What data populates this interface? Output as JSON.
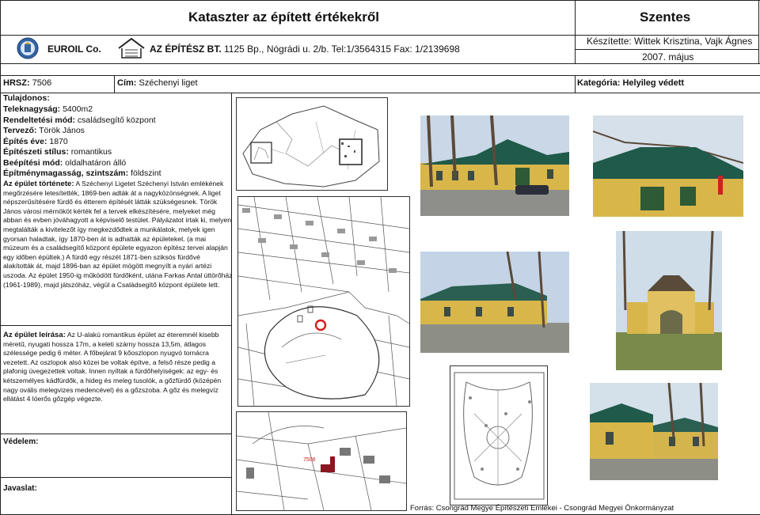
{
  "header": {
    "title": "Kataszter az épített értékekről",
    "city": "Szentes",
    "company": "EUROIL Co.",
    "architect_bold": "AZ ÉPÍTÉSZ BT.",
    "architect_rest": " 1125 Bp., Nógrádi u. 2/b. Tel:1/3564315 Fax: 1/2139698",
    "made_by": "Készítette: Wittek Krisztina, Vajk Ágnes",
    "date": "2007. május"
  },
  "record": {
    "hrsz_label": "HRSZ:",
    "hrsz_value": " 7506",
    "cim_label": "Cím:",
    "cim_value": " Széchenyi liget",
    "kategoria": "Kategória: Helyileg védett"
  },
  "fields": [
    {
      "label": "Tulajdonos:",
      "value": ""
    },
    {
      "label": "Teleknagyság:",
      "value": " 5400m2"
    },
    {
      "label": "Rendeltetési mód:",
      "value": " családsegítő központ"
    },
    {
      "label": "Tervező:",
      "value": " Török János"
    },
    {
      "label": "Építés éve:",
      "value": " 1870"
    },
    {
      "label": "Építészeti stílus:",
      "value": " romantikus"
    },
    {
      "label": "Beépítési mód:",
      "value": " oldalhatáron álló"
    },
    {
      "label": "Építménymagasság, szintszám:",
      "value": " földszint"
    }
  ],
  "tortenete": {
    "label": "Az épület története:",
    "text": " A Széchenyi Ligetet Széchenyi István emlékének megőrzésére letesítették, 1869-ben adták át a nagyközönségnek. A liget népszerűsítésére fürdő és étterem építését látták szükségesnek. Török János városi mérnököt kérték fel a tervek elkészítésére, melyeket még abban és evben jóváhagyott a képviselő testület. Pályázatot írtak ki, melyen megtalálták a kivitelezőt így megkezdődtek a munkálatok, melyek igen gyorsan haladtak, így 1870-ben át is adhatták az épületeket. (a mai múzeum és a családsegítő központ épülete egyazon építész tervei alapján egy időben épültek.) A fürdő egy részét 1871-ben sziksós fürdővé alakították át, majd 1896-ban az épület mögött megnyílt a nyári artézi uszoda. Az épület 1950-ig működött fürdőként, utána Farkas Antal úttörőház (1961-1989), majd játszóház, végül a Családsegítő központ épülete lett."
  },
  "leirasa": {
    "label": "Az épület leírása:",
    "text": " Az U-alakú romantikus épület az éteremnél kisebb méretű, nyugati hossza 17m, a keleti szárny hossza 13,5m, átlagos szélessége pedig 6 méter. A főbejárat 9 kőoszlopon nyugvó tornácra vezetett. Az oszlopok alsó közei be voltak építve, a felső része pedig a plafonig üvegezettek voltak. Innen nyíltak a fürdőhelyiségek: az egy- és kétszemélyes kádfürdők, a hideg és meleg tusolók, a gőzfürdő (középén nagy ovális melegvizes medencével) és a gőzszoba. A gőz és melegvíz ellátást 4 lóerős gőzgép végezte."
  },
  "vedelem": {
    "label": "Védelem:"
  },
  "javaslat": {
    "label": "Javaslat:"
  },
  "map_parcel": "7506",
  "source": "Forrás: Csongrád Megye Építészeti Emlékei - Csongrád Megyei Önkormányzat",
  "colors": {
    "accent_red": "#d0201a",
    "wall_yellow": "#d8b64a",
    "roof_green": "#1f5a4a",
    "grass": "#7a8a4a"
  }
}
